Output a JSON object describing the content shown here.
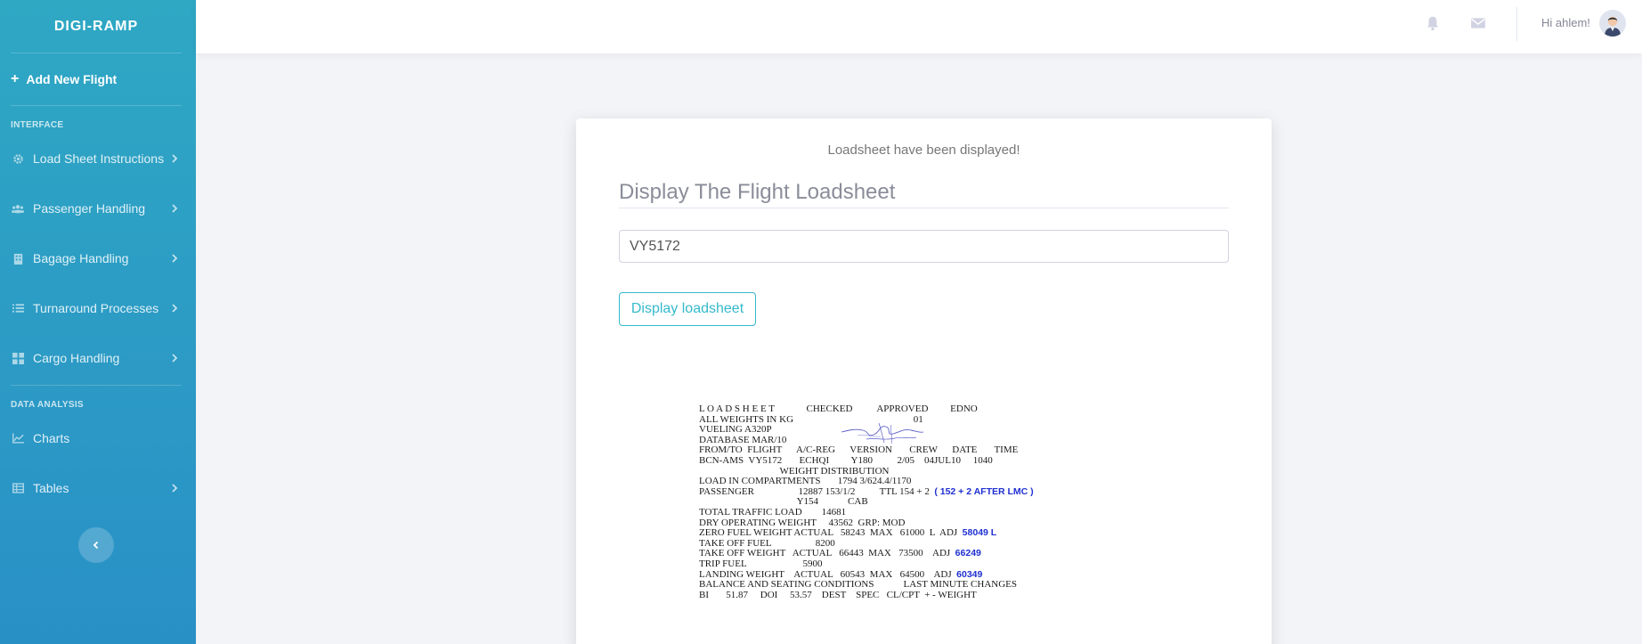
{
  "sidebar": {
    "brand": "DIGI-RAMP",
    "add_flight": "Add New Flight",
    "section_interface": "INTERFACE",
    "section_data": "DATA ANALYSIS",
    "items": [
      {
        "label": "Load Sheet Instructions",
        "icon": "gear-icon"
      },
      {
        "label": "Passenger Handling",
        "icon": "users-icon"
      },
      {
        "label": "Bagage Handling",
        "icon": "building-icon"
      },
      {
        "label": "Turnaround Processes",
        "icon": "list-icon"
      },
      {
        "label": "Cargo Handling",
        "icon": "grid-icon"
      },
      {
        "label": "Charts",
        "icon": "chart-icon"
      },
      {
        "label": "Tables",
        "icon": "table-icon"
      }
    ],
    "colors": {
      "gradient_top": "#2fa8c4",
      "gradient_bottom": "#2990c6"
    }
  },
  "topbar": {
    "greeting": "Hi ahlem!",
    "icons": [
      "bell-icon",
      "envelope-icon"
    ]
  },
  "card": {
    "status": "Loadsheet have been displayed!",
    "title": "Display The Flight Loadsheet",
    "flight_value": "VY5172",
    "button_label": "Display loadsheet",
    "accent": "#36b9cc"
  },
  "loadsheet": {
    "lines": [
      "L O A D S H E E T             CHECKED          APPROVED         EDNO",
      "ALL WEIGHTS IN KG                                                 01",
      "VUELING A320P",
      "DATABASE MAR/10",
      "",
      "FROM/TO  FLIGHT      A/C-REG      VERSION       CREW      DATE       TIME",
      "BCN-AMS  VY5172       ECHQI         Y180          2/05    04JUL10     1040",
      "",
      "                                 WEIGHT DISTRIBUTION",
      "LOAD IN COMPARTMENTS       1794 3/624.4/1170",
      "",
      "PASSENGER                  12887 153/1/2          TTL 154 + 2",
      "                                        Y154            CAB",
      "TOTAL TRAFFIC LOAD        14681",
      "DRY OPERATING WEIGHT     43562  GRP: MOD",
      "ZERO FUEL WEIGHT ACTUAL   58243  MAX   61000  L  ADJ",
      "TAKE OFF FUEL                  8200",
      "TAKE OFF WEIGHT   ACTUAL   66443  MAX   73500    ADJ",
      "TRIP FUEL                       5900",
      "LANDING WEIGHT    ACTUAL   60543  MAX   64500    ADJ",
      "",
      "BALANCE AND SEATING CONDITIONS            LAST MINUTE CHANGES",
      "BI       51.87     DOI     53.57    DEST    SPEC   CL/CPT  + - WEIGHT"
    ],
    "annotations": {
      "pax_note": "( 152 + 2 AFTER LMC )",
      "zfw_adj": "58049 L",
      "tow_adj": "66249",
      "lw_adj": "60349"
    }
  }
}
